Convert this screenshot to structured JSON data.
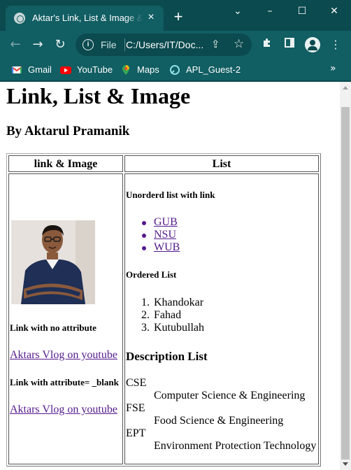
{
  "browser": {
    "tab_title": "Aktar's Link, List & Image & Ta",
    "tab_close": "×",
    "new_tab": "+",
    "window_controls": {
      "minimize": "⌄",
      "min": "–",
      "max": "☐",
      "close": "✕"
    },
    "nav": {
      "back": "←",
      "forward": "→",
      "reload": "↻"
    },
    "omnibox": {
      "scheme": "File",
      "url": "C:/Users/IT/Doc...",
      "info_icon": "i"
    },
    "toolbar_icons": {
      "extensions": "puzzle-icon",
      "sidepanel": "sidepanel-icon",
      "menu": "⋮"
    },
    "bookmarks": [
      {
        "label": "Gmail",
        "icon": "gmail-icon"
      },
      {
        "label": "YouTube",
        "icon": "youtube-icon"
      },
      {
        "label": "Maps",
        "icon": "maps-icon"
      },
      {
        "label": "APL_Guest-2",
        "icon": "apl-icon"
      }
    ],
    "bookmarks_more": "»"
  },
  "page": {
    "title": "Link, List & Image",
    "author": "By Aktarul Pramanik",
    "table": {
      "header_left": "link & Image",
      "header_right": "List",
      "left": {
        "photo_alt": "photo",
        "label_no_attr": "Link with no attribute",
        "link_1": "Aktars Vlog on youtube",
        "label_attr": "Link with attribute= _blank",
        "link_2": "Aktars Vlog on youtube"
      },
      "right": {
        "unordered_title": "Unorderd list with link",
        "unordered_items": [
          "GUB",
          "NSU",
          "WUB"
        ],
        "ordered_title": "Ordered List",
        "ordered_items": [
          "Khandokar",
          "Fahad",
          "Kutubullah"
        ],
        "ordered_markers": [
          "1.",
          "2.",
          "3."
        ],
        "description_title": "Description List",
        "description_items": [
          {
            "term": "CSE",
            "desc": "Computer Science & Engineering"
          },
          {
            "term": "FSE",
            "desc": "Food Science & Engineering"
          },
          {
            "term": "EPT",
            "desc": "Environment Protection Technology"
          }
        ]
      }
    }
  }
}
